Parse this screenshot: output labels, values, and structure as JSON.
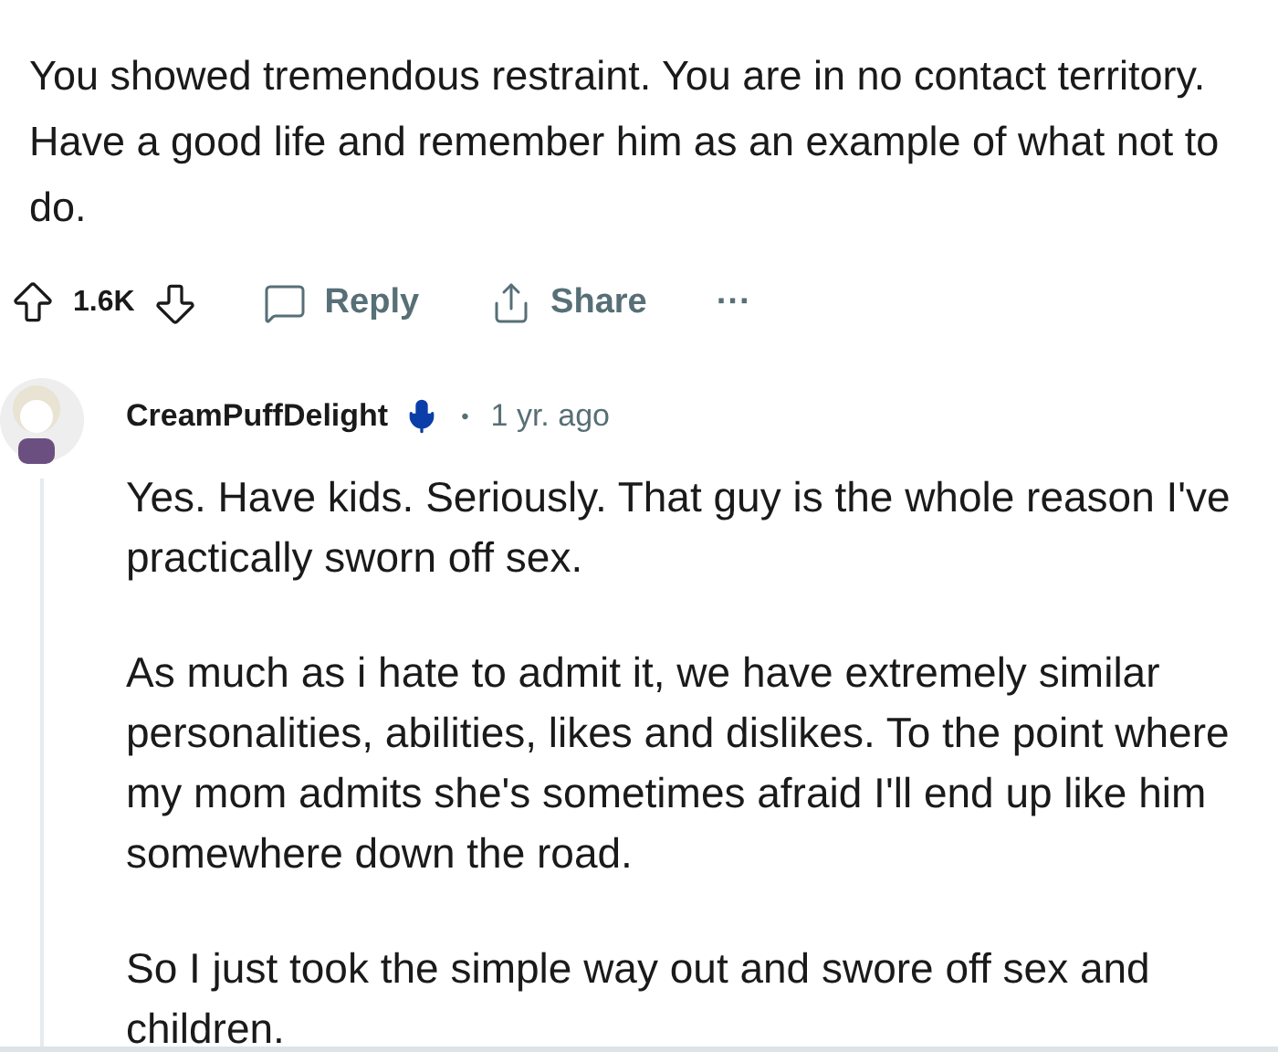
{
  "parent_comment": {
    "body": "You showed tremendous restraint. You are in no contact territory. Have a good life and remember him as an example of what not to do.",
    "vote_count": "1.6K",
    "actions": [
      {
        "kind": "reply",
        "label": "Reply"
      },
      {
        "kind": "share",
        "label": "Share"
      },
      {
        "kind": "more",
        "label": "···"
      }
    ]
  },
  "reply": {
    "username": "CreamPuffDelight",
    "voice_badge": true,
    "separator": "•",
    "time": "1 yr. ago",
    "paragraphs": [
      "Yes. Have kids. Seriously. That guy is the whole reason I've practically sworn off sex.",
      "As much as i hate to admit it, we have extremely similar personalities, abilities, likes and dislikes. To the point where my mom admits she's sometimes afraid I'll end up like him somewhere down the road.",
      "So I just took the simple way out and swore off sex and children."
    ]
  }
}
